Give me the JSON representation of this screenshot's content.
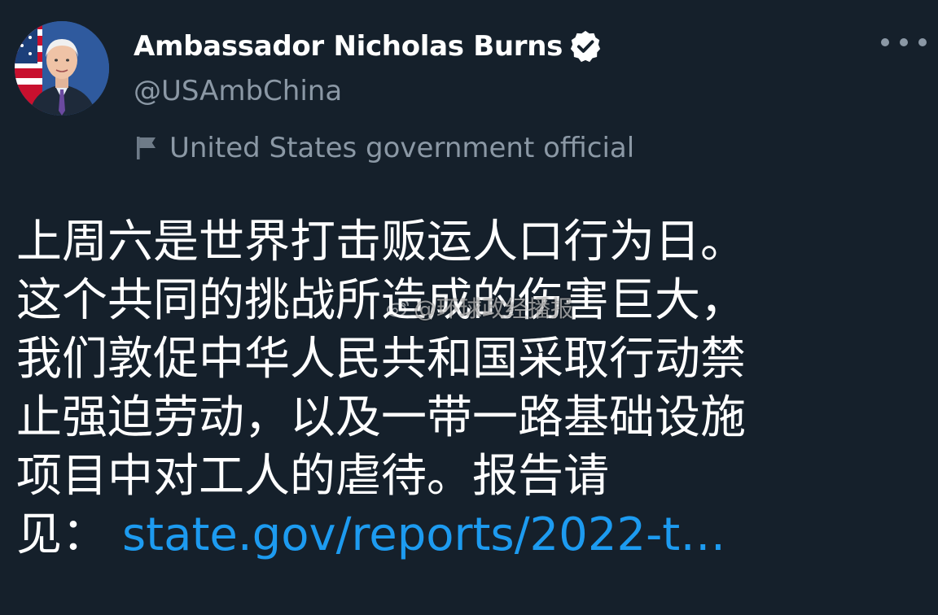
{
  "tweet": {
    "display_name": "Ambassador Nicholas Burns",
    "handle": "@USAmbChina",
    "account_label": "United States government official",
    "body_lines": [
      "上周六是世界打击贩运人口行为日。",
      "这个共同的挑战所造成的伤害巨大，",
      "我们敦促中华人民共和国采取行动禁",
      "止强迫劳动，以及一带一路基础设施",
      "项目中对工人的虐待。报告请"
    ],
    "last_line_prefix": "见：",
    "link_text": "state.gov/reports/2022-t…"
  },
  "icons": {
    "verified": "verified-badge-icon",
    "label": "flag-icon",
    "more": "more-dots-icon",
    "watermark_logo": "weibo-logo"
  },
  "watermark": {
    "text": "@环球政经播报"
  },
  "colors": {
    "background": "#15202b",
    "text": "#ffffff",
    "secondary": "#8b98a5",
    "link": "#1d9bf0"
  }
}
